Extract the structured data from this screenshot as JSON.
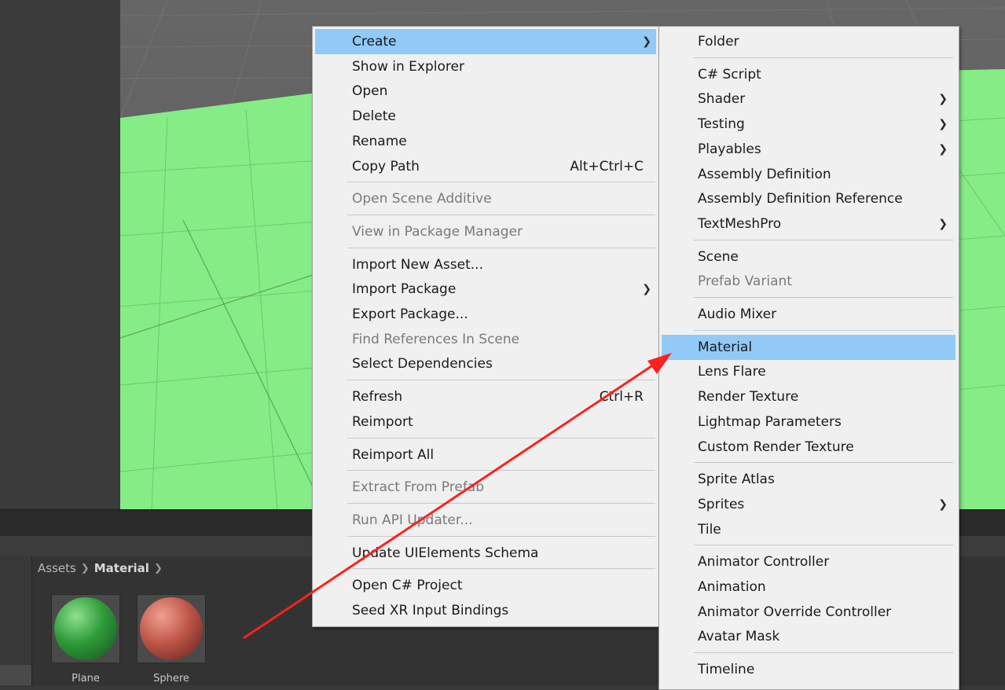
{
  "breadcrumb": {
    "root": "Assets",
    "current": "Material"
  },
  "assets": [
    {
      "name": "Plane",
      "color": "#2f9c3a"
    },
    {
      "name": "Sphere",
      "color": "#c0574a"
    }
  ],
  "context_menu": {
    "items": [
      {
        "label": "Create",
        "submenu": true,
        "highlighted": true
      },
      {
        "label": "Show in Explorer"
      },
      {
        "label": "Open"
      },
      {
        "label": "Delete"
      },
      {
        "label": "Rename"
      },
      {
        "label": "Copy Path",
        "shortcut": "Alt+Ctrl+C"
      },
      {
        "label": "Open Scene Additive",
        "disabled": true
      },
      {
        "label": "View in Package Manager",
        "disabled": true
      },
      {
        "label": "Import New Asset..."
      },
      {
        "label": "Import Package",
        "submenu": true
      },
      {
        "label": "Export Package..."
      },
      {
        "label": "Find References In Scene",
        "disabled": true
      },
      {
        "label": "Select Dependencies"
      },
      {
        "label": "Refresh",
        "shortcut": "Ctrl+R"
      },
      {
        "label": "Reimport"
      },
      {
        "label": "Reimport All"
      },
      {
        "label": "Extract From Prefab",
        "disabled": true
      },
      {
        "label": "Run API Updater...",
        "disabled": true
      },
      {
        "label": "Update UIElements Schema"
      },
      {
        "label": "Open C# Project"
      },
      {
        "label": "Seed XR Input Bindings"
      }
    ]
  },
  "create_submenu": {
    "items": [
      {
        "label": "Folder"
      },
      {
        "label": "C# Script"
      },
      {
        "label": "Shader",
        "submenu": true
      },
      {
        "label": "Testing",
        "submenu": true
      },
      {
        "label": "Playables",
        "submenu": true
      },
      {
        "label": "Assembly Definition"
      },
      {
        "label": "Assembly Definition Reference"
      },
      {
        "label": "TextMeshPro",
        "submenu": true
      },
      {
        "label": "Scene"
      },
      {
        "label": "Prefab Variant",
        "disabled": true
      },
      {
        "label": "Audio Mixer"
      },
      {
        "label": "Material",
        "highlighted": true
      },
      {
        "label": "Lens Flare"
      },
      {
        "label": "Render Texture"
      },
      {
        "label": "Lightmap Parameters"
      },
      {
        "label": "Custom Render Texture"
      },
      {
        "label": "Sprite Atlas"
      },
      {
        "label": "Sprites",
        "submenu": true
      },
      {
        "label": "Tile"
      },
      {
        "label": "Animator Controller"
      },
      {
        "label": "Animation"
      },
      {
        "label": "Animator Override Controller"
      },
      {
        "label": "Avatar Mask"
      },
      {
        "label": "Timeline"
      }
    ]
  },
  "colors": {
    "menu_bg": "#f0f0f0",
    "highlight": "#91c9f7",
    "ground": "#86ec86",
    "annotation_arrow": "#ff2020"
  }
}
